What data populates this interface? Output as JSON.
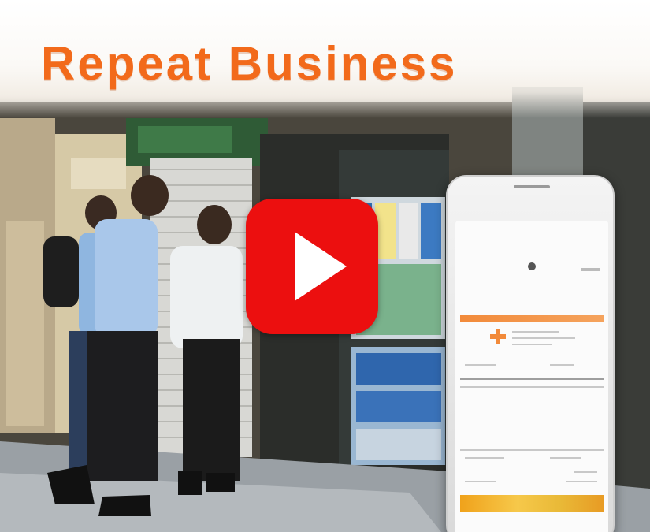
{
  "banner": {
    "title": "Repeat Business"
  },
  "play": {
    "icon": "play-icon"
  },
  "colors": {
    "title": "#f26a1b",
    "play_button": "#ec0f0f",
    "receipt_accent": "#f28a3a"
  }
}
